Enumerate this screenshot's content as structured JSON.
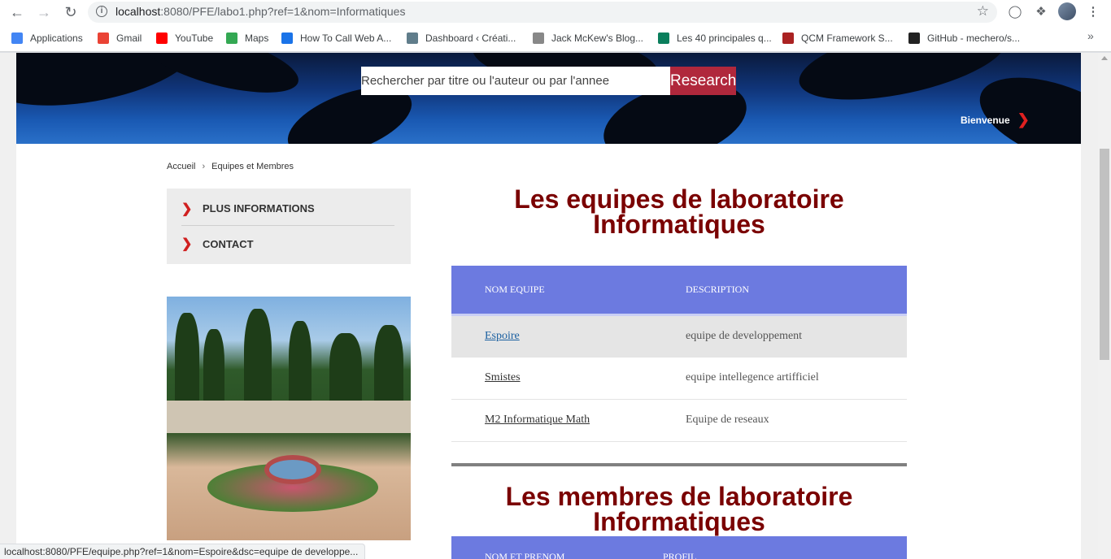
{
  "browser": {
    "url_host": "localhost",
    "url_rest": ":8080/PFE/labo1.php?ref=1&nom=Informatiques",
    "status_url": "localhost:8080/PFE/equipe.php?ref=1&nom=Espoire&dsc=equipe de developpe..."
  },
  "bookmarks": [
    {
      "label": "Applications",
      "icon": "apps-grid-icon",
      "color": "#4285f4"
    },
    {
      "label": "Gmail",
      "icon": "gmail-icon",
      "color": "#ea4335"
    },
    {
      "label": "YouTube",
      "icon": "youtube-icon",
      "color": "#ff0000"
    },
    {
      "label": "Maps",
      "icon": "maps-icon",
      "color": "#34a853"
    },
    {
      "label": "How To Call Web A...",
      "icon": "refresh-blue-icon",
      "color": "#1a73e8"
    },
    {
      "label": "Dashboard ‹ Créati...",
      "icon": "dashboard-icon",
      "color": "#607d8b"
    },
    {
      "label": "Jack McKew's Blog...",
      "icon": "blog-icon",
      "color": "#888888"
    },
    {
      "label": "Les 40 principales q...",
      "icon": "green-square-icon",
      "color": "#0a7e5c"
    },
    {
      "label": "QCM Framework S...",
      "icon": "wix-icon",
      "color": "#aa2222"
    },
    {
      "label": "GitHub - mechero/s...",
      "icon": "github-icon",
      "color": "#222222"
    }
  ],
  "header": {
    "search_placeholder": "Rechercher par titre ou l'auteur ou par l'annee",
    "search_button": "Research",
    "welcome": "Bienvenue"
  },
  "breadcrumb": {
    "home": "Accueil",
    "current": "Equipes et Membres"
  },
  "sidebar": {
    "items": [
      {
        "label": "PLUS INFORMATIONS"
      },
      {
        "label": "CONTACT"
      }
    ]
  },
  "teams_section": {
    "title_line1": "Les equipes de laboratoire",
    "title_line2": "Informatiques",
    "col_name": "NOM EQUIPE",
    "col_desc": "DESCRIPTION",
    "rows": [
      {
        "name": "Espoire",
        "desc": "equipe de developpement"
      },
      {
        "name": "Smistes",
        "desc": "equipe intellegence artifficiel"
      },
      {
        "name": "M2 Informatique Math",
        "desc": "Equipe de reseaux"
      }
    ]
  },
  "members_section": {
    "title_line1": "Les membres de laboratoire",
    "title_line2": "Informatiques",
    "col1": "NOM ET PRENOM",
    "col2": "PROFIL"
  },
  "colors": {
    "accent_red": "#b0283c",
    "title_color": "#7a0000",
    "table_header": "#6c7ae0"
  }
}
